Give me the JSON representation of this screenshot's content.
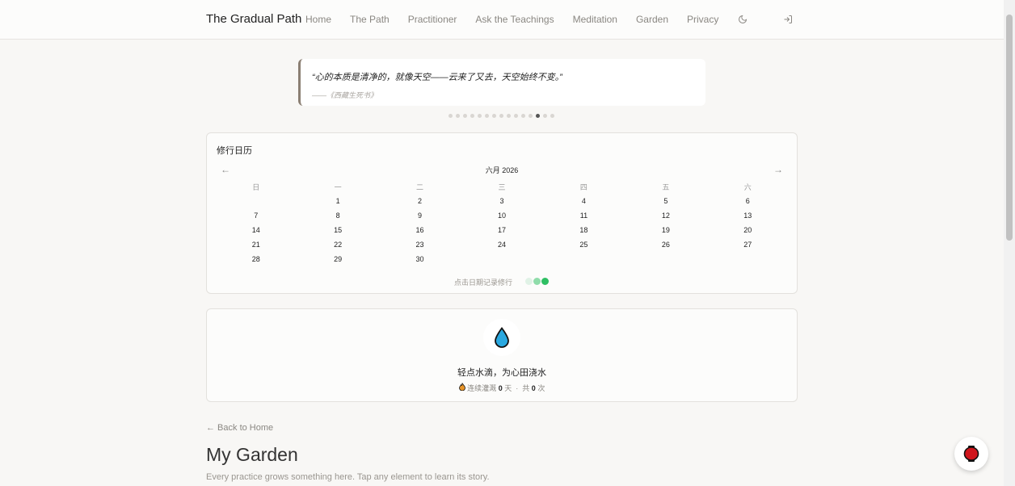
{
  "header": {
    "brand": "The Gradual Path",
    "nav": [
      "Home",
      "The Path",
      "Practitioner",
      "Ask the Teachings",
      "Meditation",
      "Garden",
      "Privacy"
    ],
    "icons": [
      "moon-icon",
      "login-icon"
    ]
  },
  "quote": {
    "text": "“心的本质是清净的，就像天空——云来了又去，天空始终不变。”",
    "source": "——《西藏生死书》",
    "dots_total": 15,
    "active_dot": 12
  },
  "calendar": {
    "title": "修行日历",
    "prev": "←",
    "next": "→",
    "month_label": "六月 2026",
    "weekdays": [
      "日",
      "一",
      "二",
      "三",
      "四",
      "五",
      "六"
    ],
    "first_weekday_offset": 1,
    "days_in_month": 30,
    "hint": "点击日期记录修行",
    "legend_colors": [
      "#e0f2e6",
      "#8fdcaa",
      "#2ebf63"
    ]
  },
  "water": {
    "label": "轻点水滴，为心田浇水",
    "streak_prefix": "连续灌溉",
    "streak_value": "0",
    "streak_unit": "天",
    "separator": "·",
    "total_prefix": "共",
    "total_value": "0",
    "total_unit": "次",
    "colors": {
      "drop": "#29a8e0",
      "outline": "#111111"
    }
  },
  "page": {
    "back_link": "← Back to Home",
    "title": "My Garden",
    "subtitle": "Every practice grows something here. Tap any element to learn its story."
  },
  "fab": {
    "icon": "lantern-icon",
    "color": "#d0151c"
  }
}
